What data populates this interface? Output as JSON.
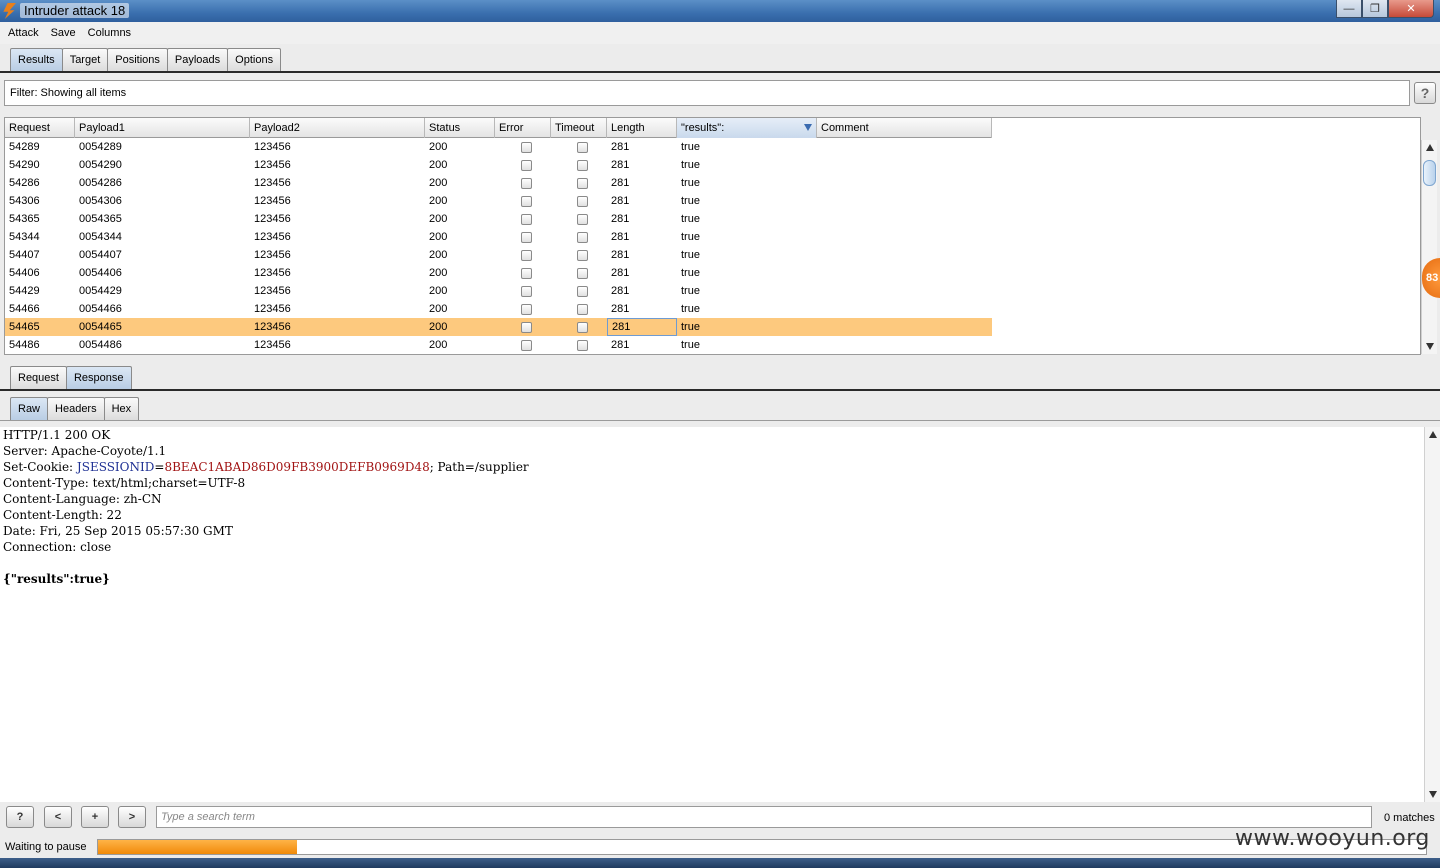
{
  "window": {
    "title": "Intruder attack 18",
    "close": "✕",
    "min": "—",
    "max": "❐"
  },
  "menu": [
    "Attack",
    "Save",
    "Columns"
  ],
  "main_tabs": [
    {
      "label": "Results",
      "active": true
    },
    {
      "label": "Target",
      "active": false
    },
    {
      "label": "Positions",
      "active": false
    },
    {
      "label": "Payloads",
      "active": false
    },
    {
      "label": "Options",
      "active": false
    }
  ],
  "filter": {
    "text": "Filter:  Showing all items",
    "help": "?"
  },
  "table": {
    "columns": [
      "Request",
      "Payload1",
      "Payload2",
      "Status",
      "Error",
      "Timeout",
      "Length",
      "\"results\":",
      "Comment"
    ],
    "rows": [
      {
        "request": "54289",
        "payload1": "0054289",
        "payload2": "123456",
        "status": "200",
        "length": "281",
        "results": "true"
      },
      {
        "request": "54290",
        "payload1": "0054290",
        "payload2": "123456",
        "status": "200",
        "length": "281",
        "results": "true"
      },
      {
        "request": "54286",
        "payload1": "0054286",
        "payload2": "123456",
        "status": "200",
        "length": "281",
        "results": "true"
      },
      {
        "request": "54306",
        "payload1": "0054306",
        "payload2": "123456",
        "status": "200",
        "length": "281",
        "results": "true"
      },
      {
        "request": "54365",
        "payload1": "0054365",
        "payload2": "123456",
        "status": "200",
        "length": "281",
        "results": "true"
      },
      {
        "request": "54344",
        "payload1": "0054344",
        "payload2": "123456",
        "status": "200",
        "length": "281",
        "results": "true"
      },
      {
        "request": "54407",
        "payload1": "0054407",
        "payload2": "123456",
        "status": "200",
        "length": "281",
        "results": "true"
      },
      {
        "request": "54406",
        "payload1": "0054406",
        "payload2": "123456",
        "status": "200",
        "length": "281",
        "results": "true"
      },
      {
        "request": "54429",
        "payload1": "0054429",
        "payload2": "123456",
        "status": "200",
        "length": "281",
        "results": "true"
      },
      {
        "request": "54466",
        "payload1": "0054466",
        "payload2": "123456",
        "status": "200",
        "length": "281",
        "results": "true"
      },
      {
        "request": "54465",
        "payload1": "0054465",
        "payload2": "123456",
        "status": "200",
        "length": "281",
        "results": "true",
        "selected": true
      },
      {
        "request": "54486",
        "payload1": "0054486",
        "payload2": "123456",
        "status": "200",
        "length": "281",
        "results": "true"
      }
    ]
  },
  "side_badge": "83",
  "detail_tabs": [
    {
      "label": "Request",
      "active": false
    },
    {
      "label": "Response",
      "active": true
    }
  ],
  "view_tabs": [
    {
      "label": "Raw",
      "active": true
    },
    {
      "label": "Headers",
      "active": false
    },
    {
      "label": "Hex",
      "active": false
    }
  ],
  "response": {
    "status_line": "HTTP/1.1 200 OK",
    "server": "Server: Apache-Coyote/1.1",
    "cookie_prefix": "Set-Cookie: ",
    "cookie_name": "JSESSIONID",
    "cookie_eq": "=",
    "cookie_value": "8BEAC1ABAD86D09FB3900DEFB0969D48",
    "cookie_suffix": "; Path=/supplier",
    "content_type": "Content-Type: text/html;charset=UTF-8",
    "content_language": "Content-Language: zh-CN",
    "content_length": "Content-Length: 22",
    "date": "Date: Fri, 25 Sep 2015 05:57:30 GMT",
    "connection": "Connection: close",
    "body": "{\"results\":true}"
  },
  "search": {
    "help": "?",
    "prev": "<",
    "add": "+",
    "next": ">",
    "placeholder": "Type a search term",
    "matches": "0 matches"
  },
  "status": {
    "text": "Waiting to pause",
    "progress": 0.15
  },
  "watermark": "www.wooyun.org",
  "colors": {
    "selected_row": "#fdc97e",
    "progress": "#f08a0a",
    "cookie_name": "#1d2f93",
    "cookie_value": "#a11313"
  }
}
